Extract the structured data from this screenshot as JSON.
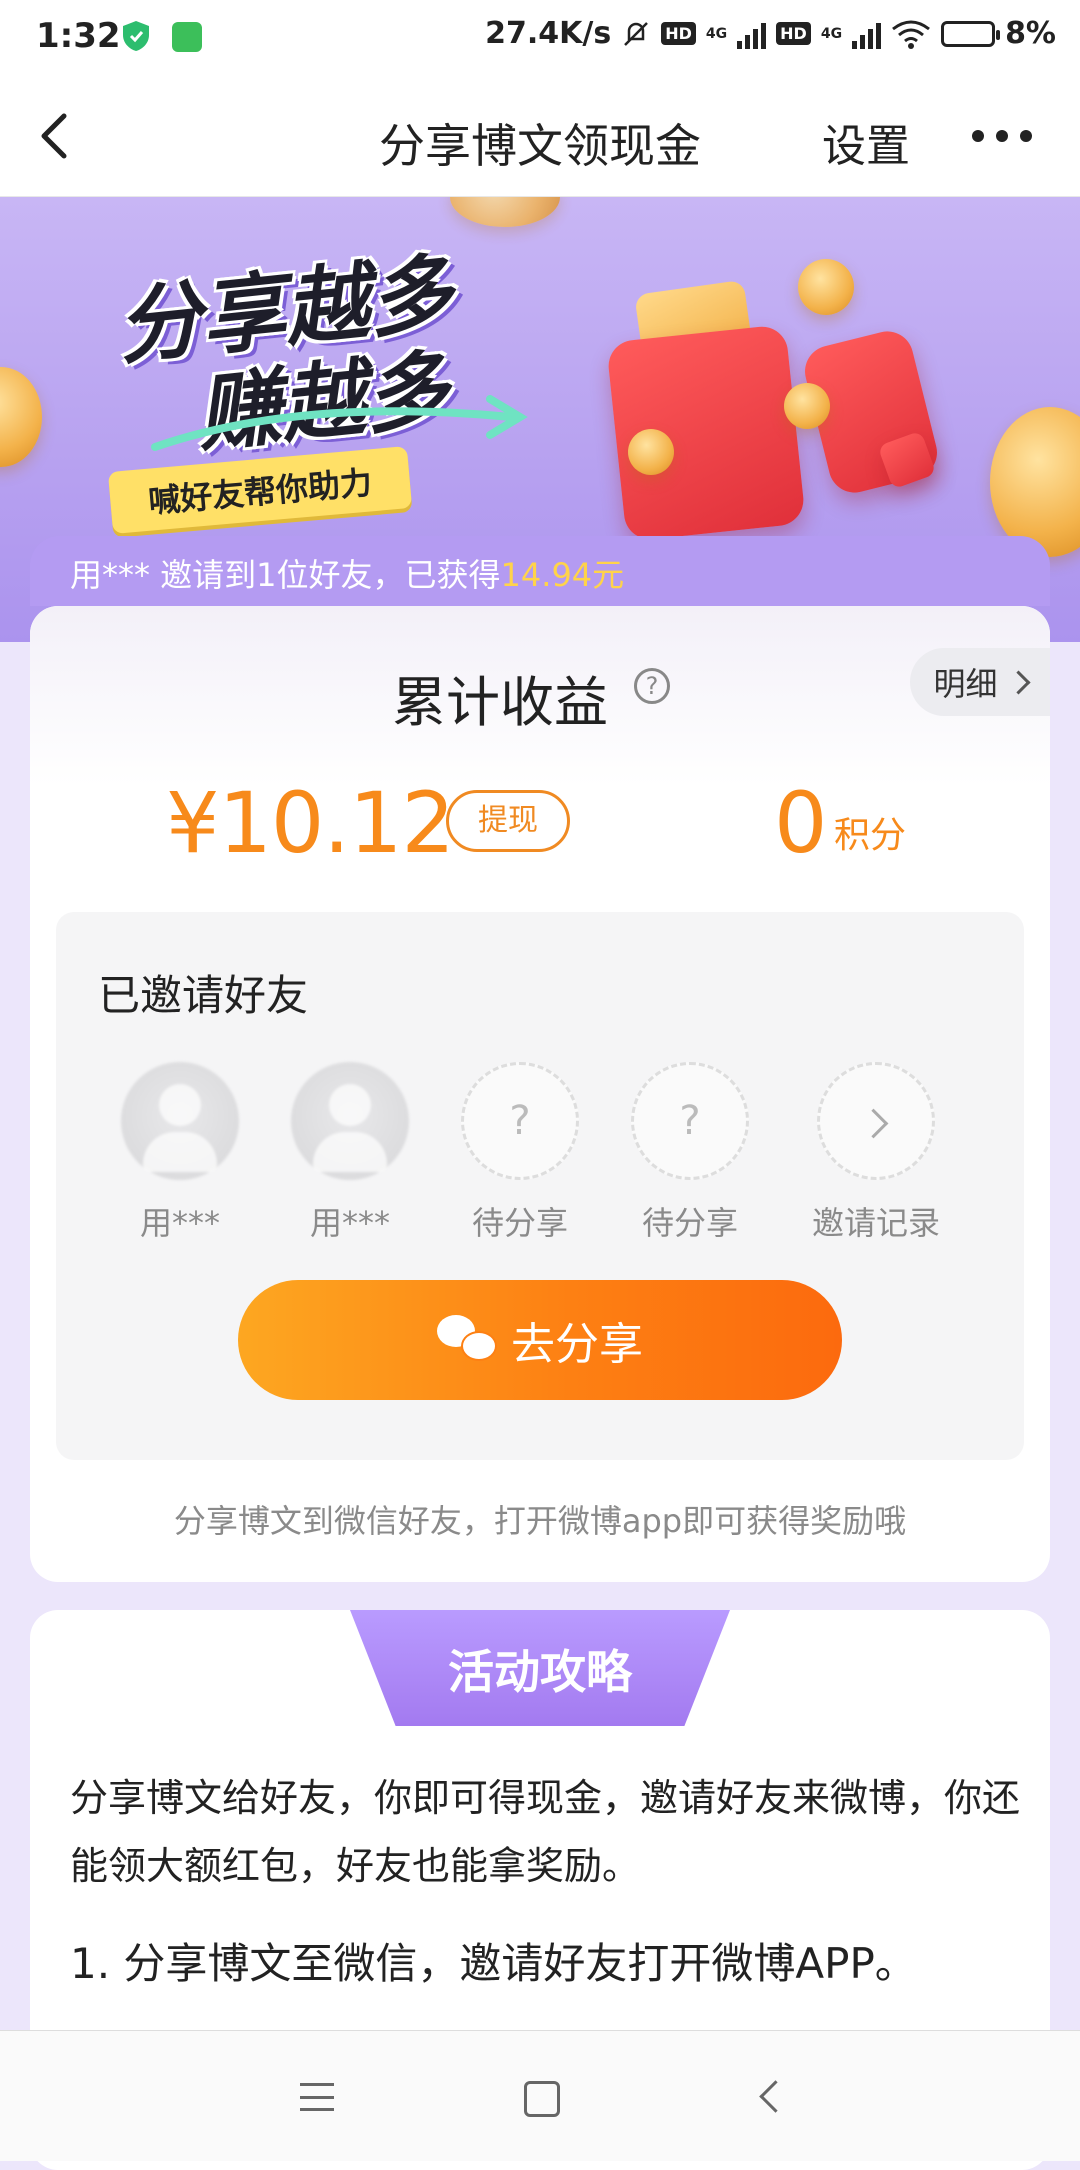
{
  "status_bar": {
    "time": "1:32",
    "speed": "27.4K/s",
    "hd1": "HD",
    "net1": "4G",
    "hd2": "HD",
    "net2": "4G",
    "battery": "8%"
  },
  "nav": {
    "back_icon": "chevron-left-icon",
    "title": "分享博文领现金",
    "settings_label": "设置",
    "more_icon": "more-dots-icon"
  },
  "banner": {
    "slogan_line1": "分享越多",
    "slogan_line2": "赚越多",
    "tag": "喊好友帮你助力"
  },
  "ticker": {
    "prefix": "用*** 邀请到1位好友，已获得",
    "amount": "14.94元"
  },
  "earnings": {
    "title": "累计收益",
    "help_icon": "?",
    "detail_label": "明细",
    "money": "¥10.12",
    "withdraw_label": "提现",
    "points_value": "0",
    "points_unit": "积分"
  },
  "invite": {
    "title": "已邀请好友",
    "slots": [
      {
        "label": "用***",
        "kind": "avatar"
      },
      {
        "label": "用***",
        "kind": "avatar"
      },
      {
        "label": "待分享",
        "kind": "pending",
        "glyph": "?"
      },
      {
        "label": "待分享",
        "kind": "pending",
        "glyph": "?"
      },
      {
        "label": "邀请记录",
        "kind": "record"
      }
    ],
    "share_label": "去分享",
    "hint": "分享博文到微信好友，打开微博app即可获得奖励哦"
  },
  "guide": {
    "tab_label": "活动攻略",
    "paragraph": "分享博文给好友，你即可得现金，邀请好友来微博，你还能领大额红包，好友也能拿奖励。",
    "step1": "1. 分享博文至微信，邀请好友打开微博APP。"
  },
  "colors": {
    "accent_orange": "#f78a1b",
    "banner_purple": "#b7a1f0",
    "ticker_gold": "#ffd34a"
  }
}
